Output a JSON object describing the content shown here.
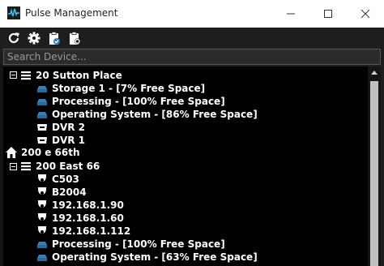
{
  "window": {
    "title": "Pulse Management"
  },
  "toolbar": {
    "icons": [
      "refresh-icon",
      "gear-icon",
      "clipboard-check-icon",
      "clipboard-gear-icon"
    ]
  },
  "search": {
    "placeholder": "Search Device..."
  },
  "colors": {
    "background": "#1e1e1e",
    "tree_background": "#000000",
    "text": "#ffffff",
    "storage_icon": "#3b7fb0"
  },
  "tree": {
    "site1": {
      "label": "20 Sutton Place",
      "children": [
        "Storage 1 - [7% Free Space]",
        "Processing - [100% Free Space]",
        "Operating System - [86% Free Space]",
        "DVR 2",
        "DVR 1"
      ]
    },
    "site2": {
      "label": "200 e 66th",
      "group": {
        "label": "200 East 66",
        "children": [
          "C503",
          "B2004",
          "192.168.1.90",
          "192.168.1.60",
          "192.168.1.112",
          "Processing - [100% Free Space]",
          "Operating System - [63% Free Space]"
        ]
      }
    }
  }
}
